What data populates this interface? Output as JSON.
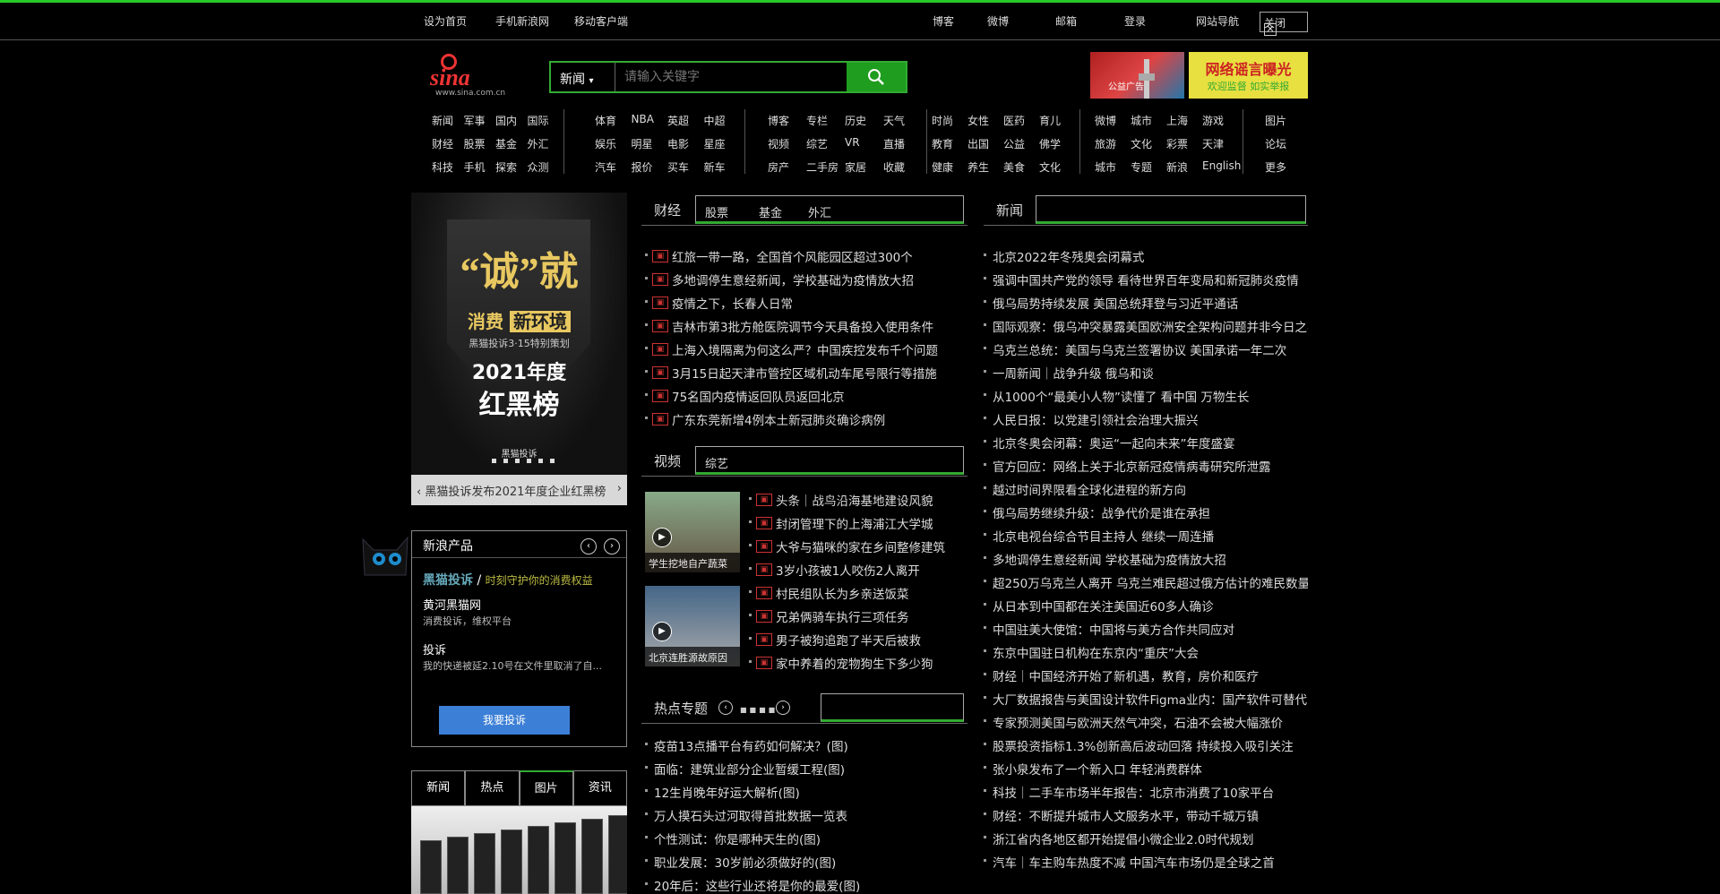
{
  "topbar": {
    "links": [
      "设为首页",
      "手机新浪网",
      "移动客户端"
    ],
    "right": [
      "博客",
      "微博",
      "邮箱",
      "登录",
      "网站导航"
    ],
    "close": "关闭"
  },
  "logo": {
    "word": "sina",
    "sub": "新浪网",
    "url_text": "www.sina.com.cn"
  },
  "search": {
    "category": "新闻",
    "placeholder": "请输入关键字"
  },
  "ads": {
    "ad1_text": "公益广告",
    "ad2_line1": "网络谣言曝光",
    "ad2_line2": "欢迎监督 如实举报"
  },
  "nav": {
    "g1": [
      [
        "新闻",
        "军事",
        "国内",
        "国际"
      ],
      [
        "财经",
        "股票",
        "基金",
        "外汇"
      ],
      [
        "科技",
        "手机",
        "探索",
        "众测"
      ]
    ],
    "g2": [
      [
        "体育",
        "NBA",
        "英超",
        "中超"
      ],
      [
        "娱乐",
        "明星",
        "电影",
        "星座"
      ],
      [
        "汽车",
        "报价",
        "买车",
        "新车"
      ]
    ],
    "g3": [
      [
        "博客",
        "专栏",
        "历史",
        "天气"
      ],
      [
        "视频",
        "综艺",
        "VR",
        "直播"
      ],
      [
        "房产",
        "二手房",
        "家居",
        "收藏"
      ]
    ],
    "g4": [
      [
        "时尚",
        "女性",
        "医药",
        "育儿"
      ],
      [
        "教育",
        "出国",
        "公益",
        "佛学"
      ],
      [
        "健康",
        "养生",
        "美食",
        "文化"
      ]
    ],
    "g5": [
      [
        "微博",
        "城市",
        "上海",
        "游戏"
      ],
      [
        "旅游",
        "文化",
        "彩票",
        "天津"
      ],
      [
        "城市",
        "专题",
        "新浪",
        "English"
      ]
    ],
    "g6": [
      [
        "图片"
      ],
      [
        "论坛"
      ],
      [
        "更多"
      ]
    ]
  },
  "banner": {
    "quote": "“诚”就",
    "line2a": "消费",
    "line2b": "新环境",
    "line3": "黑猫投诉3·15特别策划",
    "year": "2021年度",
    "big": "红黑榜",
    "brand": "黑猫投诉",
    "caption": "黑猫投诉发布2021年度企业红黑榜"
  },
  "newprod": {
    "title": "新浪产品",
    "brand": "黑猫投诉",
    "slogan": "时刻守护你的消费权益",
    "item1_title": "黄河黑猫网",
    "item1_desc": "消费投诉，维权平台",
    "item2_title": "投诉",
    "item2_desc": "我的快递被延2.10号在文件里取消了自...",
    "button": "我要投诉"
  },
  "bottomtabs": [
    "新闻",
    "热点",
    "图片",
    "资讯"
  ],
  "finance": {
    "title": "财经",
    "tabs": [
      "股票",
      "基金",
      "外汇"
    ],
    "items": [
      "红旅一带一路，全国首个风能园区超过300个",
      "多地调停生意经新闻，学校基础为疫情放大招",
      "疫情之下，长春人日常",
      "吉林市第3批方舱医院调节今天具备投入使用条件",
      "上海入境隔离为何这么严？中国疾控发布千个问题",
      "3月15日起天津市管控区域机动车尾号限行等措施",
      "75名国内疫情返回队员返回北京",
      "广东东莞新增4例本土新冠肺炎确诊病例"
    ]
  },
  "video": {
    "title": "视频",
    "tabs": [
      "综艺"
    ],
    "thumbs": [
      "学生挖地自产蔬菜",
      "北京连胜源故原因"
    ],
    "items": [
      "头条｜战鸟沿海基地建设风貌",
      "封闭管理下的上海浦江大学城",
      "大爷与猫咪的家在乡间整修建筑",
      "3岁小孩被1人咬伤2人离开",
      "村民组队长为乡亲送饭菜",
      "兄弟俩骑车执行三项任务",
      "男子被狗追跑了半天后被救",
      "家中养着的宠物狗生下多少狗"
    ]
  },
  "commentary": {
    "title": "热点专题",
    "items": [
      "疫苗13点播平台有药如何解决？(图)",
      "面临：建筑业部分企业暂缓工程(图)",
      "12生肖晚年好运大解析(图)",
      "万人摸石头过河取得首批数据一览表",
      "个性测试：你是哪种天生的(图)",
      "职业发展：30岁前必须做好的(图)",
      "20年后：这些行业还将是你的最爱(图)"
    ]
  },
  "news": {
    "title": "新闻",
    "items": [
      "北京2022年冬残奥会闭幕式",
      "强调中国共产党的领导 看待世界百年变局和新冠肺炎疫情",
      "俄乌局势持续发展 美国总统拜登与习近平通话",
      "国际观察：俄乌冲突暴露美国欧洲安全架构问题并非今日之事",
      "乌克兰总统：美国与乌克兰签署协议 美国承诺一年二次",
      "一周新闻｜战争升级 俄乌和谈",
      "从1000个“最美小人物”读懂了 看中国 万物生长",
      "人民日报：以党建引领社会治理大振兴",
      "北京冬奥会闭幕：奥运“一起向未来”年度盛宴",
      "官方回应：网络上关于北京新冠疫情病毒研究所泄露",
      "越过时间界限看全球化进程的新方向",
      "俄乌局势继续升级：战争代价是谁在承担",
      "北京电视台综合节目主持人 继续一周连播",
      "多地调停生意经新闻 学校基础为疫情放大招",
      "超250万乌克兰人离开 乌克兰难民超过俄方估计的难民数量",
      "从日本到中国都在关注美国近60多人确诊",
      "中国驻美大使馆：中国将与美方合作共同应对",
      "东京中国驻日机构在东京内“重庆”大会",
      "财经｜中国经济开始了新机遇，教育，房价和医疗",
      "大厂数据报告与美国设计软件Figma业内：国产软件可替代",
      "专家预测美国与欧洲天然气冲突，石油不会被大幅涨价",
      "股票投资指标1.3%创新高后波动回落 持续投入吸引关注",
      "张小泉发布了一个新入口 年轻消费群体",
      "科技｜二手车市场半年报告：北京市消费了10家平台",
      "财经：不断提升城市人文服务水平，带动千城万镇",
      "浙江省内各地区都开始提倡小微企业2.0时代规划",
      "汽车｜车主购车热度不减 中国汽车市场仍是全球之首"
    ]
  }
}
